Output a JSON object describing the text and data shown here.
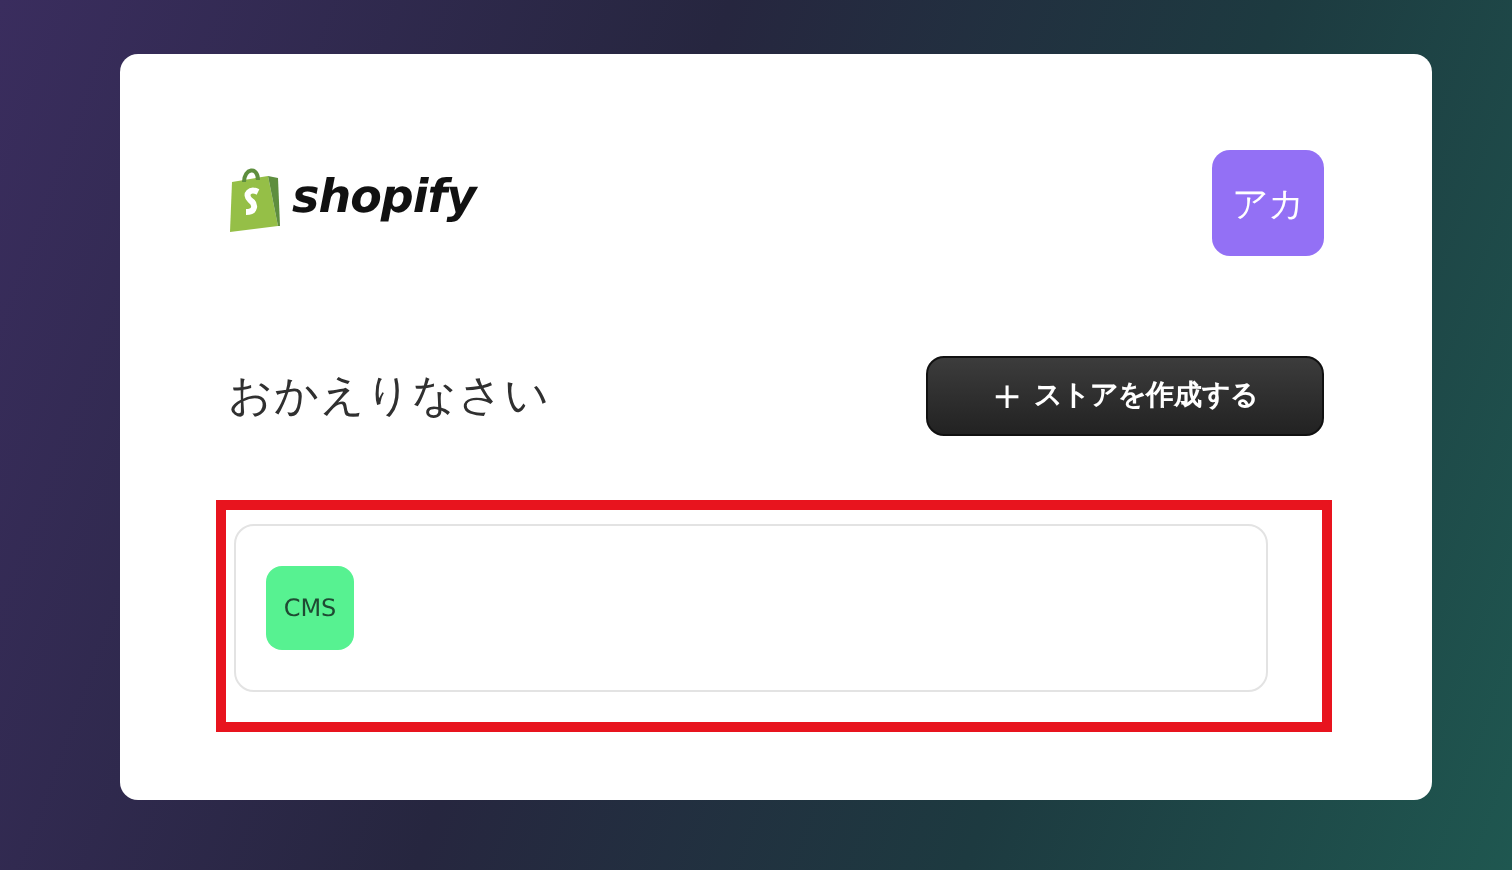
{
  "brand": {
    "name": "shopify"
  },
  "avatar": {
    "initials": "アカ",
    "color": "#9370f5"
  },
  "greeting": "おかえりなさい",
  "create_button": {
    "icon": "+",
    "label": "ストアを作成する"
  },
  "stores": [
    {
      "badge": "CMS",
      "color": "#57f291"
    }
  ],
  "highlight": {
    "on": true
  }
}
